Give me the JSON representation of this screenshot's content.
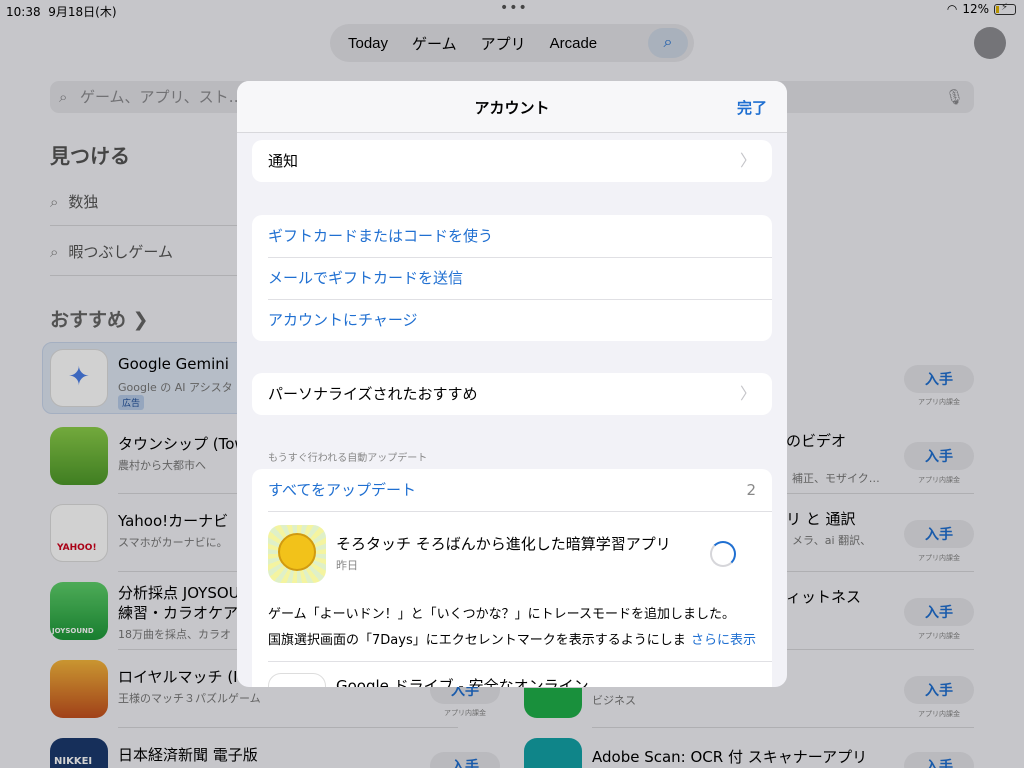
{
  "status": {
    "time": "10:38",
    "date": "9月18日(木)",
    "battery": "12%"
  },
  "tabs": [
    "Today",
    "ゲーム",
    "アプリ",
    "Arcade"
  ],
  "search": {
    "placeholder": "ゲーム、アプリ、スト…"
  },
  "discover": {
    "title": "見つける",
    "suggestions": [
      "数独",
      "暇つぶしゲーム"
    ]
  },
  "recommended": {
    "title": "おすすめ",
    "chevron": "❯"
  },
  "apps": [
    {
      "name": "Google Gemini",
      "sub": "Google の AI アシスタ",
      "ad": "広告",
      "get": "入手",
      "iap": "アプリ内課金"
    },
    {
      "name": "タウンシップ (Tow",
      "sub": "農村から大都市へ"
    },
    {
      "name": "Yahoo!カーナビ",
      "sub": "スマホがカーナビに。"
    },
    {
      "name": "分析採点 JOYSOU",
      "name2": "練習・カラオケア",
      "sub": "18万曲を採点、カラオ"
    },
    {
      "name": "ロイヤルマッチ (I",
      "sub": "王様のマッチ３パズルゲーム"
    },
    {
      "name": "日本経済新聞 電子版"
    }
  ],
  "right_apps": [
    {
      "name": "のビデオ",
      "sub": "補正、モザイク…",
      "get": "入手",
      "iap": "アプリ内課金"
    },
    {
      "name": "リ と 通訳",
      "sub": "メラ、ai 翻訳、",
      "get": "入手",
      "iap": "アプリ内課金"
    },
    {
      "name": "ィットネス",
      "get": "入手",
      "iap": "アプリ内課金"
    },
    {
      "sub": "ビジネス",
      "get": "入手",
      "iap": "アプリ内課金"
    },
    {
      "name": "Adobe Scan: OCR 付 スキャナーアプリ",
      "get": "入手"
    }
  ],
  "bg_get": {
    "label": "入手",
    "iap": "アプリ内課金"
  },
  "modal": {
    "title": "アカウント",
    "done": "完了",
    "notifications": "通知",
    "gift": [
      "ギフトカードまたはコードを使う",
      "メールでギフトカードを送信",
      "アカウントにチャージ"
    ],
    "personalized": "パーソナライズされたおすすめ",
    "updates_header": "もうすぐ行われる自動アップデート",
    "update_all": "すべてをアップデート",
    "update_count": "2",
    "update_app": {
      "name": "そろタッチ そろばんから進化した暗算学習アプリ",
      "date": "昨日",
      "notes1": "ゲーム「よーいドン！」と「いくつかな？」にトレースモードを追加しました。",
      "notes2": "国旗選択画面の「7Days」にエクセレントマークを表示するようにしま",
      "more": "さらに表示"
    },
    "next_app": {
      "name": "Google ドライブ - 安全なオンライン"
    }
  }
}
